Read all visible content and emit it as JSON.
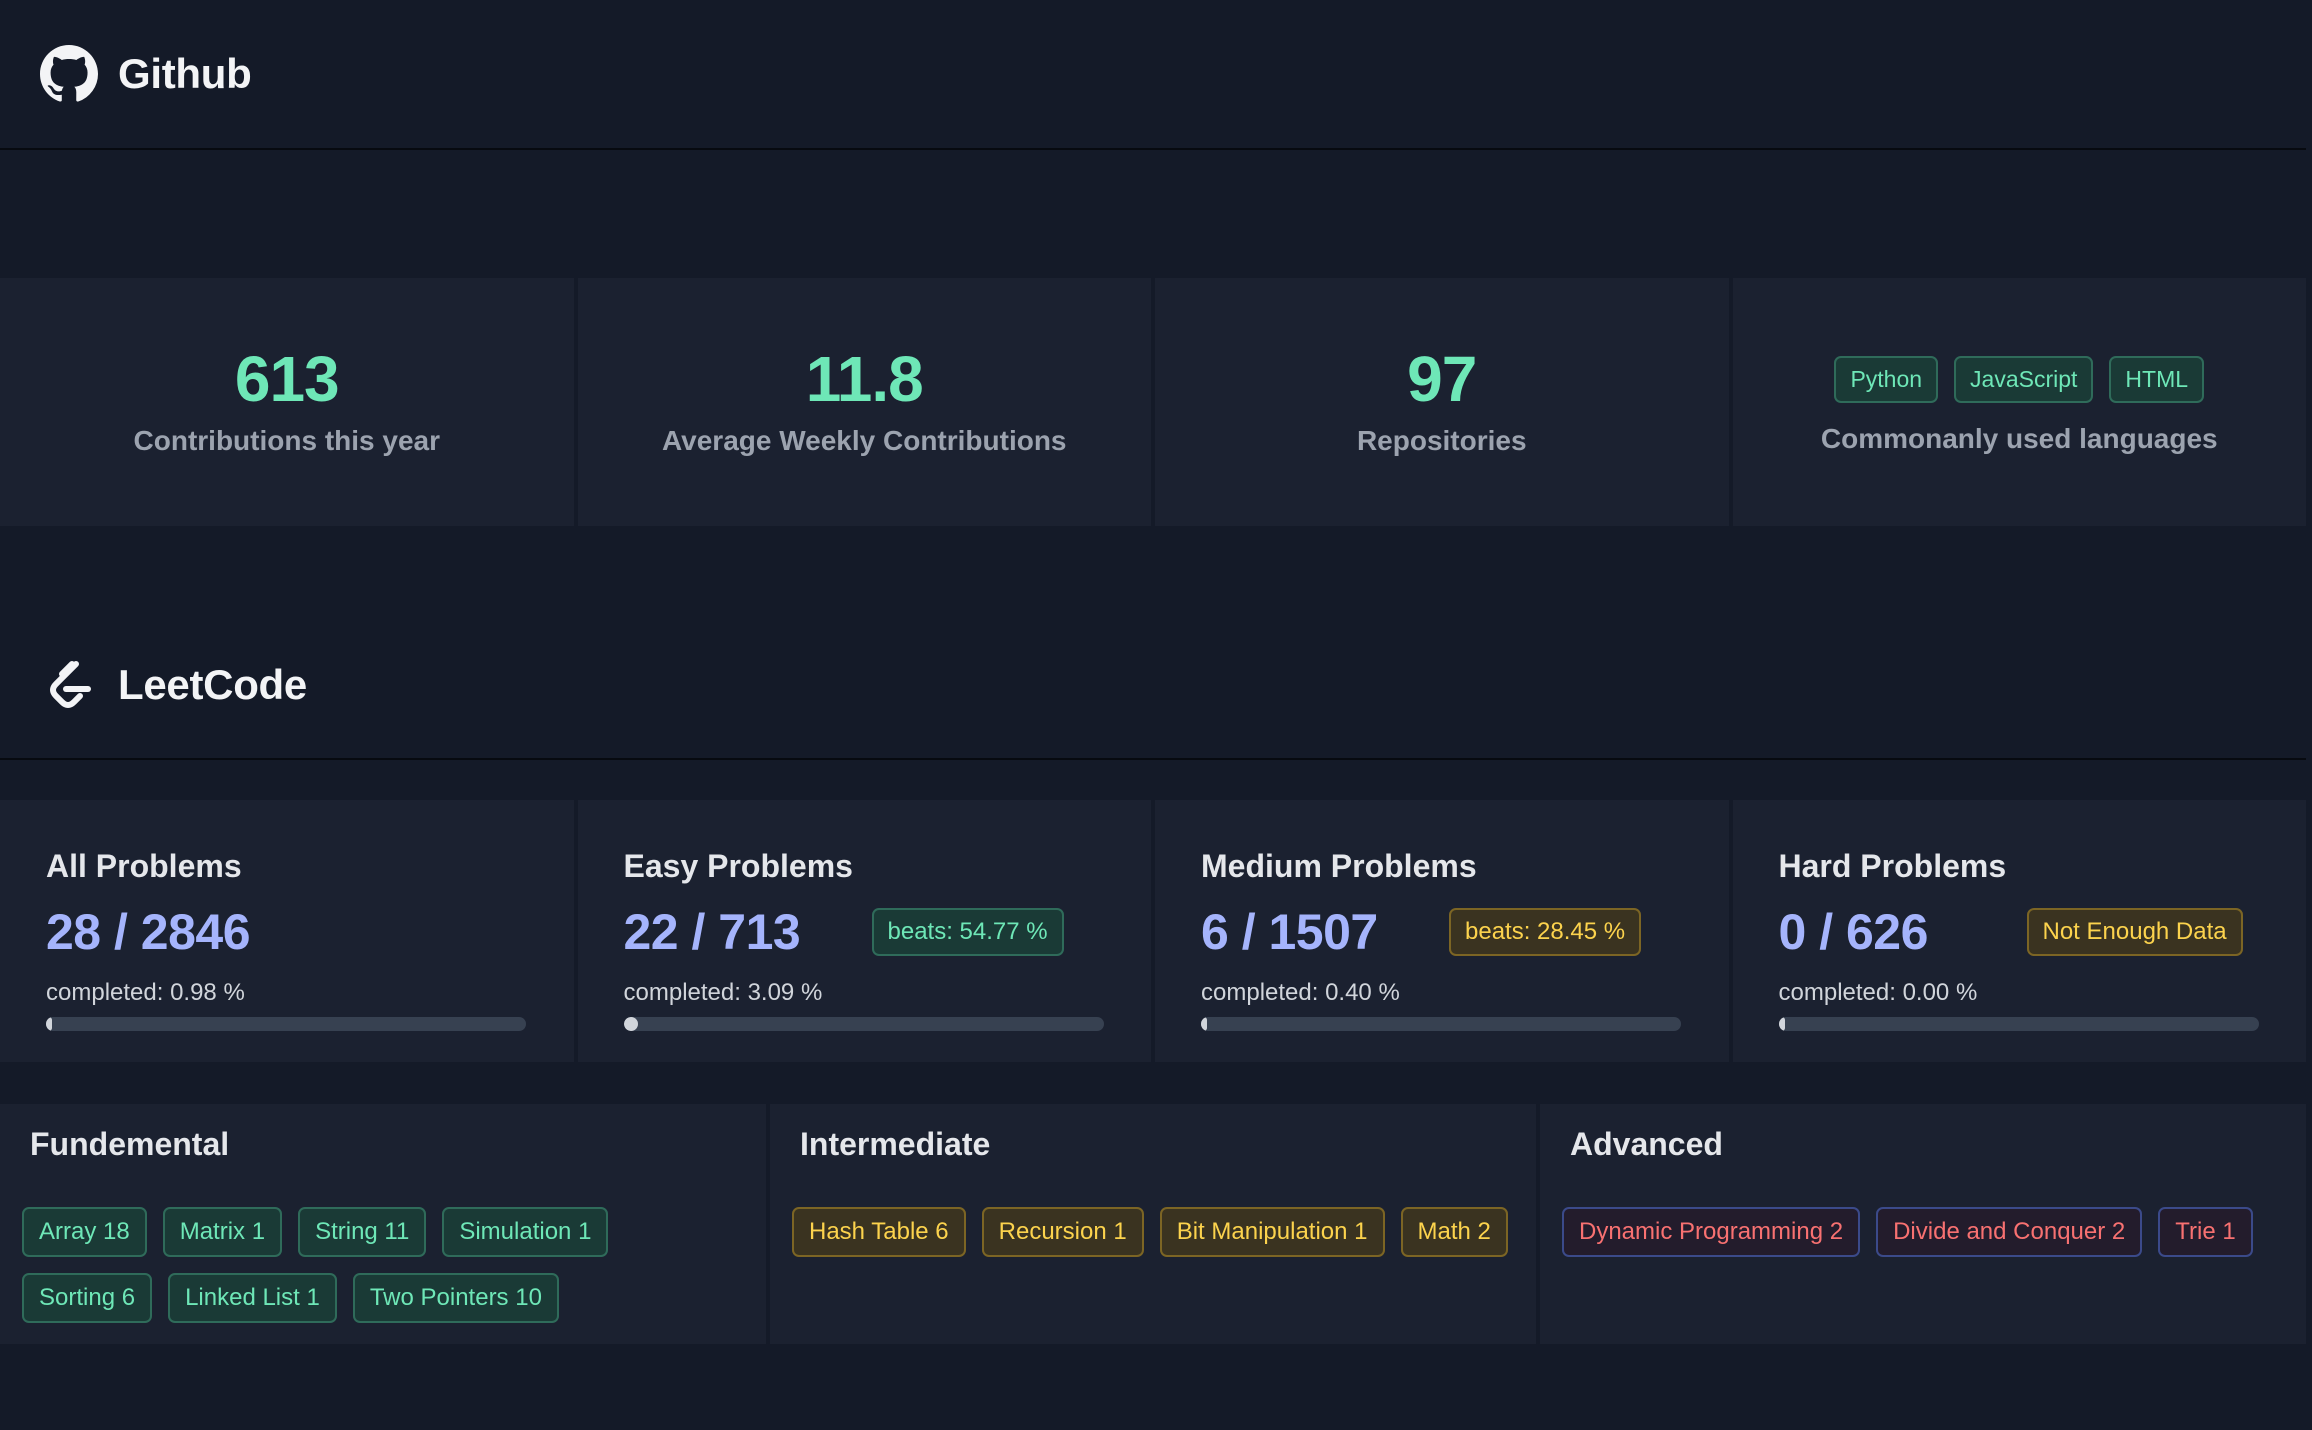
{
  "github": {
    "title": "Github",
    "stats": [
      {
        "value": "613",
        "label": "Contributions this year"
      },
      {
        "value": "11.8",
        "label": "Average Weekly Contributions"
      },
      {
        "value": "97",
        "label": "Repositories"
      }
    ],
    "languages": {
      "tags": [
        "Python",
        "JavaScript",
        "HTML"
      ],
      "label": "Commonanly used languages"
    }
  },
  "leetcode": {
    "title": "LeetCode",
    "problems": [
      {
        "title": "All Problems",
        "count": "28 / 2846",
        "badge": "",
        "completed": "completed: 0.98 %",
        "progress_percent": 0.98
      },
      {
        "title": "Easy Problems",
        "count": "22 / 713",
        "badge": "beats: 54.77 %",
        "completed": "completed: 3.09 %",
        "progress_percent": 3.09
      },
      {
        "title": "Medium Problems",
        "count": "6 / 1507",
        "badge": "beats: 28.45 %",
        "completed": "completed: 0.40 %",
        "progress_percent": 0.4
      },
      {
        "title": "Hard Problems",
        "count": "0 / 626",
        "badge": "Not Enough Data",
        "completed": "completed: 0.00 %",
        "progress_percent": 0.0
      }
    ],
    "topics": [
      {
        "title": "Fundemental",
        "tags": [
          "Array 18",
          "Matrix 1",
          "String 11",
          "Simulation 1",
          "Sorting 6",
          "Linked List 1",
          "Two Pointers 10"
        ]
      },
      {
        "title": "Intermediate",
        "tags": [
          "Hash Table 6",
          "Recursion 1",
          "Bit Manipulation 1",
          "Math 2"
        ]
      },
      {
        "title": "Advanced",
        "tags": [
          "Dynamic Programming 2",
          "Divide and Conquer 2",
          "Trie 1"
        ]
      }
    ]
  },
  "colors": {
    "background": "#141a28",
    "card": "#1b2130",
    "green": "#6ee7b7",
    "indigo": "#a5b4fc",
    "yellow": "#fcd34d",
    "red": "#f87171"
  },
  "icons": {
    "github": "github-logo-icon",
    "leetcode": "leetcode-logo-icon"
  }
}
